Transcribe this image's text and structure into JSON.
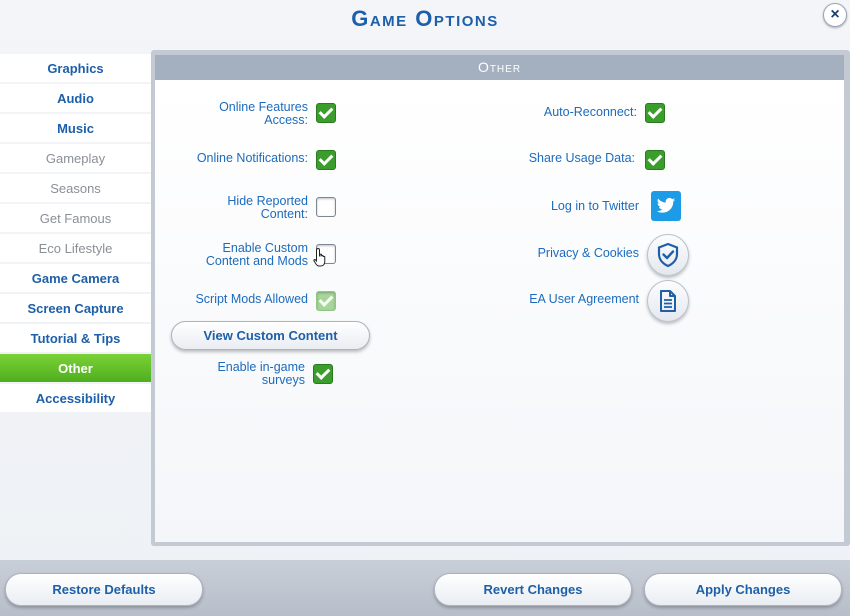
{
  "window": {
    "title": "Game Options",
    "close_label": "×"
  },
  "sidebar": {
    "items": [
      {
        "label": "Graphics",
        "state": "normal"
      },
      {
        "label": "Audio",
        "state": "normal"
      },
      {
        "label": "Music",
        "state": "normal"
      },
      {
        "label": "Gameplay",
        "state": "disabled"
      },
      {
        "label": "Seasons",
        "state": "disabled"
      },
      {
        "label": "Get Famous",
        "state": "disabled"
      },
      {
        "label": "Eco Lifestyle",
        "state": "disabled"
      },
      {
        "label": "Game Camera",
        "state": "normal"
      },
      {
        "label": "Screen Capture",
        "state": "normal"
      },
      {
        "label": "Tutorial & Tips",
        "state": "normal"
      },
      {
        "label": "Other",
        "state": "active"
      },
      {
        "label": "Accessibility",
        "state": "normal"
      }
    ]
  },
  "panel": {
    "header": "Other",
    "left_options": [
      {
        "label_line1": "Online Features",
        "label_line2": "Access:",
        "checked": true
      },
      {
        "label_line1": "Online Notifications:",
        "label_line2": "",
        "checked": true
      },
      {
        "label_line1": "Hide Reported",
        "label_line2": "Content:",
        "checked": false
      },
      {
        "label_line1": "Enable Custom",
        "label_line2": "Content and Mods",
        "checked": false
      },
      {
        "label_line1": "Script Mods Allowed",
        "label_line2": "",
        "checked": true,
        "disabled": true
      },
      {
        "label_line1": "Enable in-game",
        "label_line2": "surveys",
        "checked": true
      }
    ],
    "view_custom_content_label": "View Custom Content",
    "right_options": [
      {
        "label": "Auto-Reconnect:",
        "checked": true
      },
      {
        "label": "Share Usage Data:",
        "checked": true
      }
    ],
    "links": {
      "twitter": "Log in to Twitter",
      "privacy": "Privacy & Cookies",
      "agreement": "EA User Agreement"
    }
  },
  "footer": {
    "restore": "Restore Defaults",
    "revert": "Revert Changes",
    "apply": "Apply Changes"
  },
  "colors": {
    "accent": "#1d5fa8",
    "active_tab": "#5bbd24",
    "check_on": "#3b9d2c",
    "twitter": "#1d9be6"
  },
  "icons": {
    "close": "close-icon",
    "twitter": "twitter-icon",
    "privacy": "shield-check-icon",
    "agreement": "document-icon",
    "cursor": "hand-cursor-icon"
  }
}
